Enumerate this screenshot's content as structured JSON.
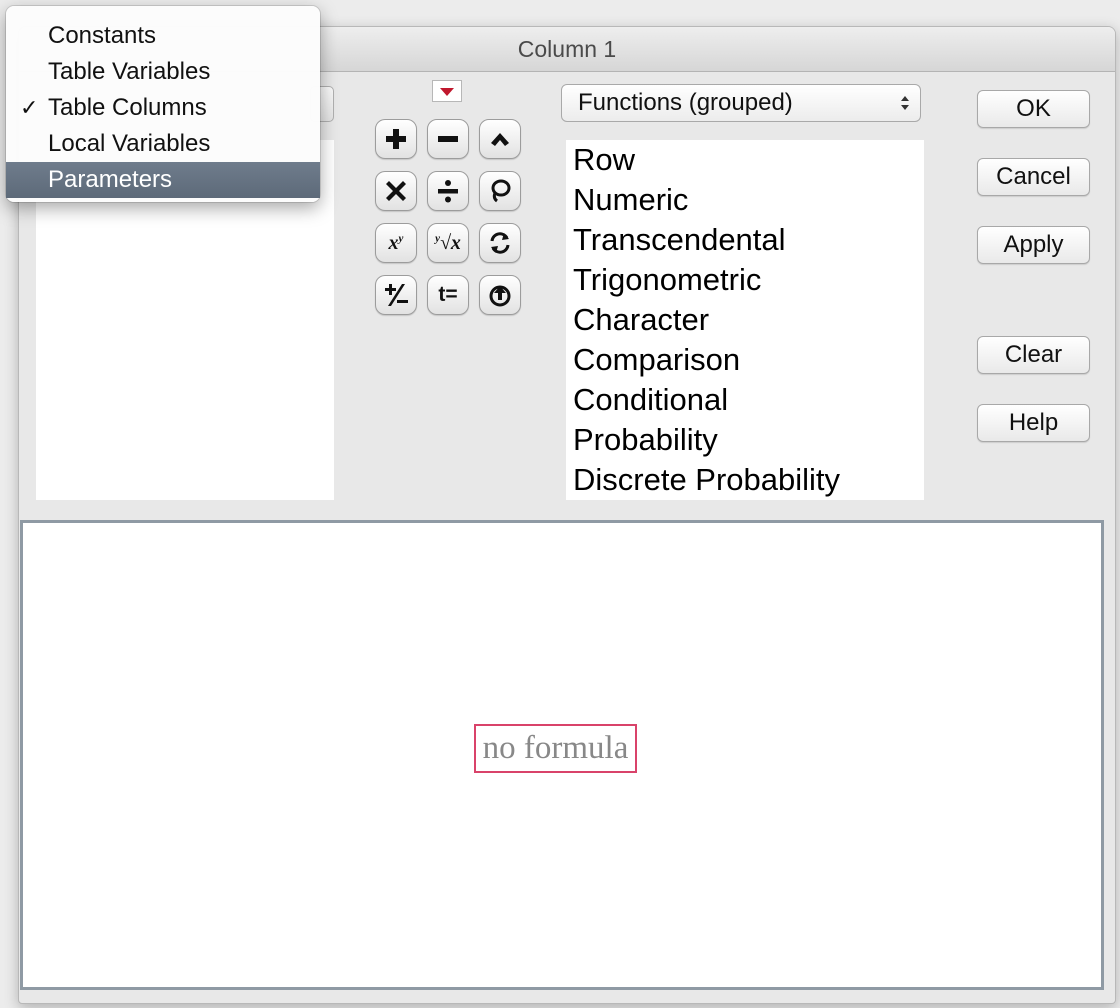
{
  "window": {
    "title": "Column 1"
  },
  "source_menu": {
    "items": [
      {
        "label": "Constants",
        "checked": false,
        "highlighted": false
      },
      {
        "label": "Table Variables",
        "checked": false,
        "highlighted": false
      },
      {
        "label": "Table Columns",
        "checked": true,
        "highlighted": false
      },
      {
        "label": "Local Variables",
        "checked": false,
        "highlighted": false
      },
      {
        "label": "Parameters",
        "checked": false,
        "highlighted": true
      }
    ],
    "check_glyph": "✓"
  },
  "keypad": {
    "keys": [
      {
        "icon": "plus-icon"
      },
      {
        "icon": "minus-icon"
      },
      {
        "icon": "caret-up-icon"
      },
      {
        "icon": "multiply-icon"
      },
      {
        "icon": "divide-icon"
      },
      {
        "icon": "lasso-icon"
      },
      {
        "icon": "power-icon",
        "text": "x",
        "sup": "y"
      },
      {
        "icon": "root-icon",
        "text": "√x",
        "sup": "y"
      },
      {
        "icon": "rotate-icon"
      },
      {
        "icon": "plus-minus-icon",
        "text": "+/−"
      },
      {
        "icon": "assign-icon",
        "text": "t="
      },
      {
        "icon": "peel-icon"
      }
    ]
  },
  "functions": {
    "selected": "Functions (grouped)",
    "items": [
      "Row",
      "Numeric",
      "Transcendental",
      "Trigonometric",
      "Character",
      "Comparison",
      "Conditional",
      "Probability",
      "Discrete Probability"
    ]
  },
  "buttons": {
    "ok": "OK",
    "cancel": "Cancel",
    "apply": "Apply",
    "clear": "Clear",
    "help": "Help"
  },
  "formula": {
    "placeholder": "no formula"
  },
  "colors": {
    "highlight": "#5d6a79",
    "formula_border": "#d9436a",
    "red_arrow": "#c0182d"
  }
}
